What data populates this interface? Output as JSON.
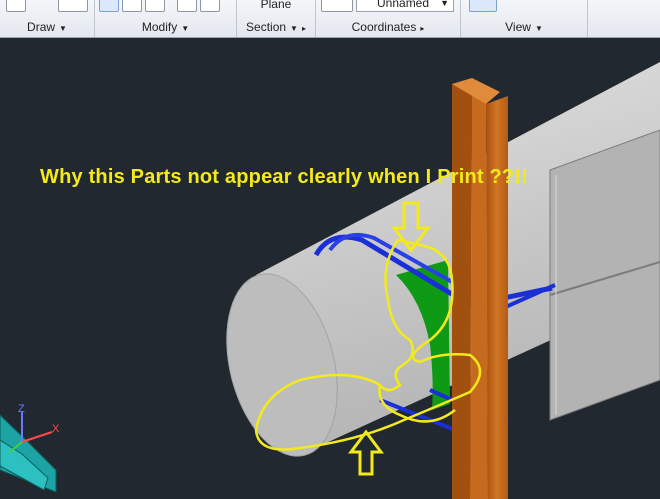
{
  "ribbon": {
    "panels": [
      {
        "label": "Draw"
      },
      {
        "label": "Modify"
      },
      {
        "label": "Section"
      },
      {
        "label": "Coordinates"
      },
      {
        "label": "View"
      }
    ],
    "section_plane_label": "Plane",
    "ucs_combo_value": "Unnamed"
  },
  "viewport": {
    "annotation_text": "Why this Parts not appear clearly when I Print ??!!",
    "ucs_icon": {
      "z_label": "Z",
      "x_label": "X"
    }
  },
  "colors": {
    "background": "#212830",
    "annotation": "#f3ea1b",
    "beam": "#c96a1c",
    "rebar": "#1a2fd6",
    "green_part": "#0f9a16"
  },
  "icons": [
    "polyline-icon",
    "arc-icon",
    "array-icon",
    "stretch-icon",
    "rotate-icon",
    "erase-icon",
    "copy-icon",
    "ucs-icon",
    "view-cube-icon"
  ]
}
